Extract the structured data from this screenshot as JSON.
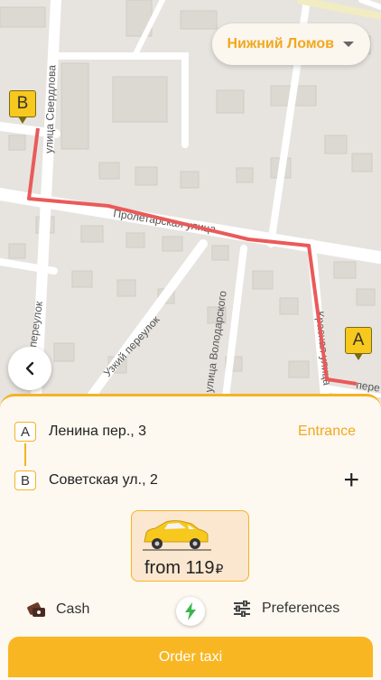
{
  "header": {
    "city": "Нижний Ломов"
  },
  "map": {
    "streets": {
      "sverdlova": "улица Свердлова",
      "proletarskaya": "Пролетарская улица",
      "pereulok": "переулок",
      "uzkiy": "Узкий переулок",
      "volodarskogo": "улица Володарского",
      "krasnaya": "Красная улица",
      "edge": "пере"
    },
    "pin_a": "A",
    "pin_b": "B",
    "route_color": "#ea5a5a"
  },
  "route": {
    "from": {
      "badge": "A",
      "address": "Ленина пер., 3",
      "action": "Entrance"
    },
    "to": {
      "badge": "B",
      "address": "Советская ул., 2",
      "action": "+"
    }
  },
  "tariff": {
    "price_prefix": "from 119",
    "currency": "₽"
  },
  "options": {
    "payment": "Cash",
    "preferences": "Preferences"
  },
  "order_button": "Order taxi",
  "colors": {
    "accent": "#f8b622",
    "accent_text": "#f2a81d",
    "pin": "#f7c81d"
  }
}
